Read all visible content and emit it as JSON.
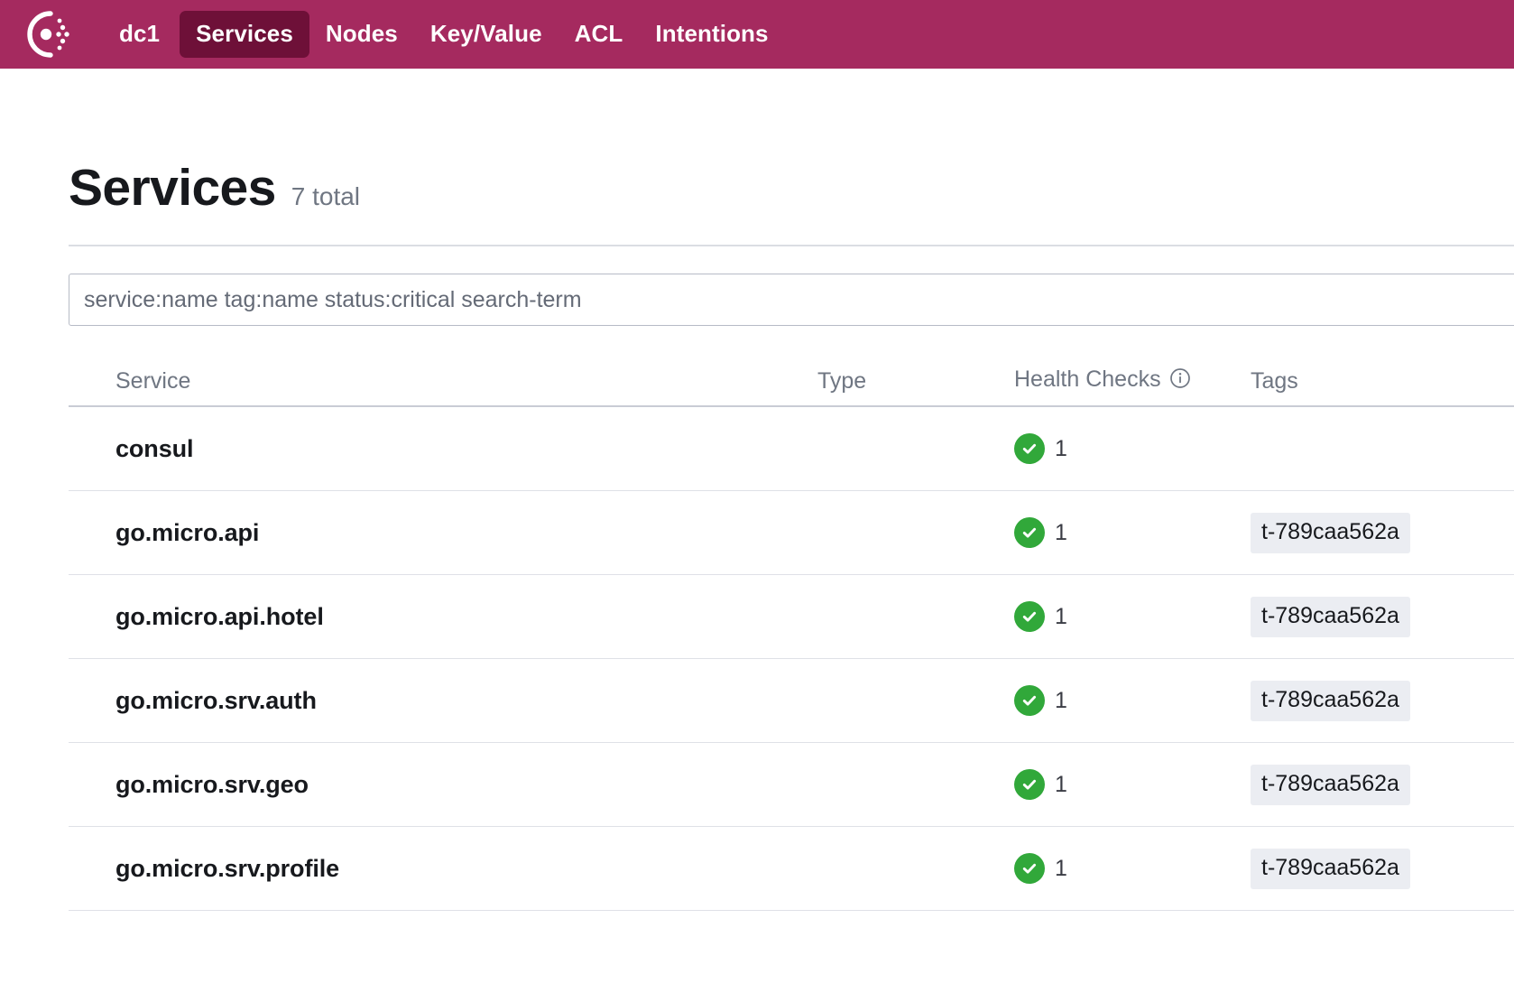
{
  "nav": {
    "logo_name": "consul-logo",
    "datacenter": "dc1",
    "items": [
      {
        "label": "Services",
        "active": true
      },
      {
        "label": "Nodes",
        "active": false
      },
      {
        "label": "Key/Value",
        "active": false
      },
      {
        "label": "ACL",
        "active": false
      },
      {
        "label": "Intentions",
        "active": false
      }
    ],
    "bg_color": "#a52a5f",
    "active_bg_color": "#6e1038"
  },
  "page": {
    "title": "Services",
    "count_label": "7 total"
  },
  "search": {
    "value": "",
    "placeholder": "service:name tag:name status:critical search-term"
  },
  "table": {
    "columns": {
      "service": "Service",
      "type": "Type",
      "health": "Health Checks",
      "tags": "Tags"
    },
    "health_info_icon": "info-icon",
    "rows": [
      {
        "service": "consul",
        "type": "",
        "health_status": "passing",
        "health_count": "1",
        "tags": []
      },
      {
        "service": "go.micro.api",
        "type": "",
        "health_status": "passing",
        "health_count": "1",
        "tags": [
          "t-789caa562a"
        ]
      },
      {
        "service": "go.micro.api.hotel",
        "type": "",
        "health_status": "passing",
        "health_count": "1",
        "tags": [
          "t-789caa562a"
        ]
      },
      {
        "service": "go.micro.srv.auth",
        "type": "",
        "health_status": "passing",
        "health_count": "1",
        "tags": [
          "t-789caa562a"
        ]
      },
      {
        "service": "go.micro.srv.geo",
        "type": "",
        "health_status": "passing",
        "health_count": "1",
        "tags": [
          "t-789caa562a"
        ]
      },
      {
        "service": "go.micro.srv.profile",
        "type": "",
        "health_status": "passing",
        "health_count": "1",
        "tags": [
          "t-789caa562a"
        ]
      }
    ],
    "passing_color": "#31a83a",
    "tag_bg_color": "#ebedf2"
  }
}
